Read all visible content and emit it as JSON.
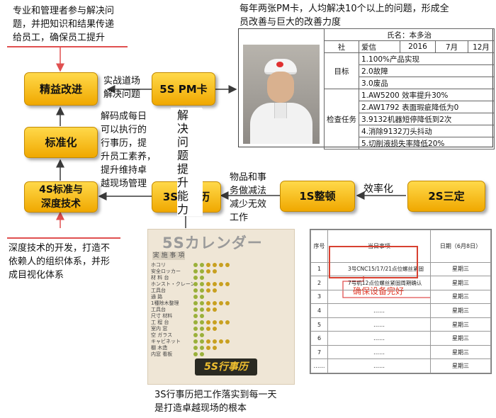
{
  "notes": {
    "top_left": [
      "专业和管理者参与解决问",
      "题，并把知识和结果传递",
      "给员工，确保员工提升"
    ],
    "top_right": [
      "每年两张PM卡，人均解决10个以上的问题，形成全",
      "员改善与巨大的改善力度"
    ],
    "bottom_left": [
      "深度技术的开发，打造不",
      "依赖人的组织体系，并形",
      "成目视化体系"
    ],
    "bottom_center": [
      "3S行事历把工作落实到每一天",
      "是打造卓越现场的根本"
    ]
  },
  "boxes": {
    "lean": "精益改进",
    "pm": "5S PM卡",
    "std": "标准化",
    "s4": [
      "4S标准与",
      "深度技术"
    ],
    "s3": "3S行事历",
    "s1": "1S整顿",
    "s2": "2S三定"
  },
  "edge_labels": {
    "pm_to_lean": [
      "实战道场",
      "解决问题"
    ],
    "s3_to_std": [
      "解码成每日",
      "可以执行的",
      "行事历，提",
      "升员工素养，",
      "提升维持卓",
      "越现场管理"
    ],
    "s3_to_pm": [
      "解",
      "决",
      "问",
      "题",
      "提",
      "升",
      "能",
      "力"
    ],
    "s1_to_s3": [
      "物品和事",
      "务做减法",
      "减少无效",
      "工作"
    ],
    "s2_to_s1": "效率化"
  },
  "pm_card": {
    "name": "氏名：本多治",
    "dept": "社",
    "company": "爱信",
    "year": "2016",
    "month1": "7月",
    "month2": "12月",
    "goal_label": "目标",
    "goals": [
      "1.100%产品实现",
      "2.0故障",
      "3.0废品"
    ],
    "task_label": "检查任务",
    "tasks": [
      "1.AW5200 效率提升30%",
      "2.AW1792 表面瑕疵降低为0",
      "3.9132机器短停降低到2次",
      "4.消除9132刀头抖动",
      "5.切削液损失率降低20%"
    ]
  },
  "calendar": {
    "title": "5Sカレンダー",
    "header": "実 施 事 項",
    "rows": [
      "ホコリ",
      "安全ロッカー",
      "材 料 台",
      "ホンスト・クレーン",
      "工具台",
      "通 路",
      "1種除木整理",
      "工具台",
      "尺寸 材料",
      "工 程 台",
      "室内 窓",
      "空 ガラス",
      "キャビネット",
      "棚 木造",
      "内窓 看板"
    ],
    "banner": "5S行事历"
  },
  "task_table": {
    "headers": [
      "序号",
      "当日事项",
      "日期（6月8日）"
    ],
    "rows": [
      [
        "1",
        "3号CNC15/17/21点位螺丝紧固",
        "星期三"
      ],
      [
        "2",
        "7号机12点位螺丝紧固周期确认",
        "星期三"
      ],
      [
        "3",
        "",
        "星期三"
      ],
      [
        "4",
        "……",
        "星期三"
      ],
      [
        "5",
        "……",
        "星期三"
      ],
      [
        "6",
        "……",
        "星期三"
      ],
      [
        "7",
        "……",
        "星期三"
      ],
      [
        "……",
        "……",
        "星期三"
      ]
    ],
    "annotation": "确保设备完好"
  },
  "colors": {
    "box_fill": "#f5b800",
    "highlight": "#e05050",
    "arrow": "#3a3a3a"
  }
}
